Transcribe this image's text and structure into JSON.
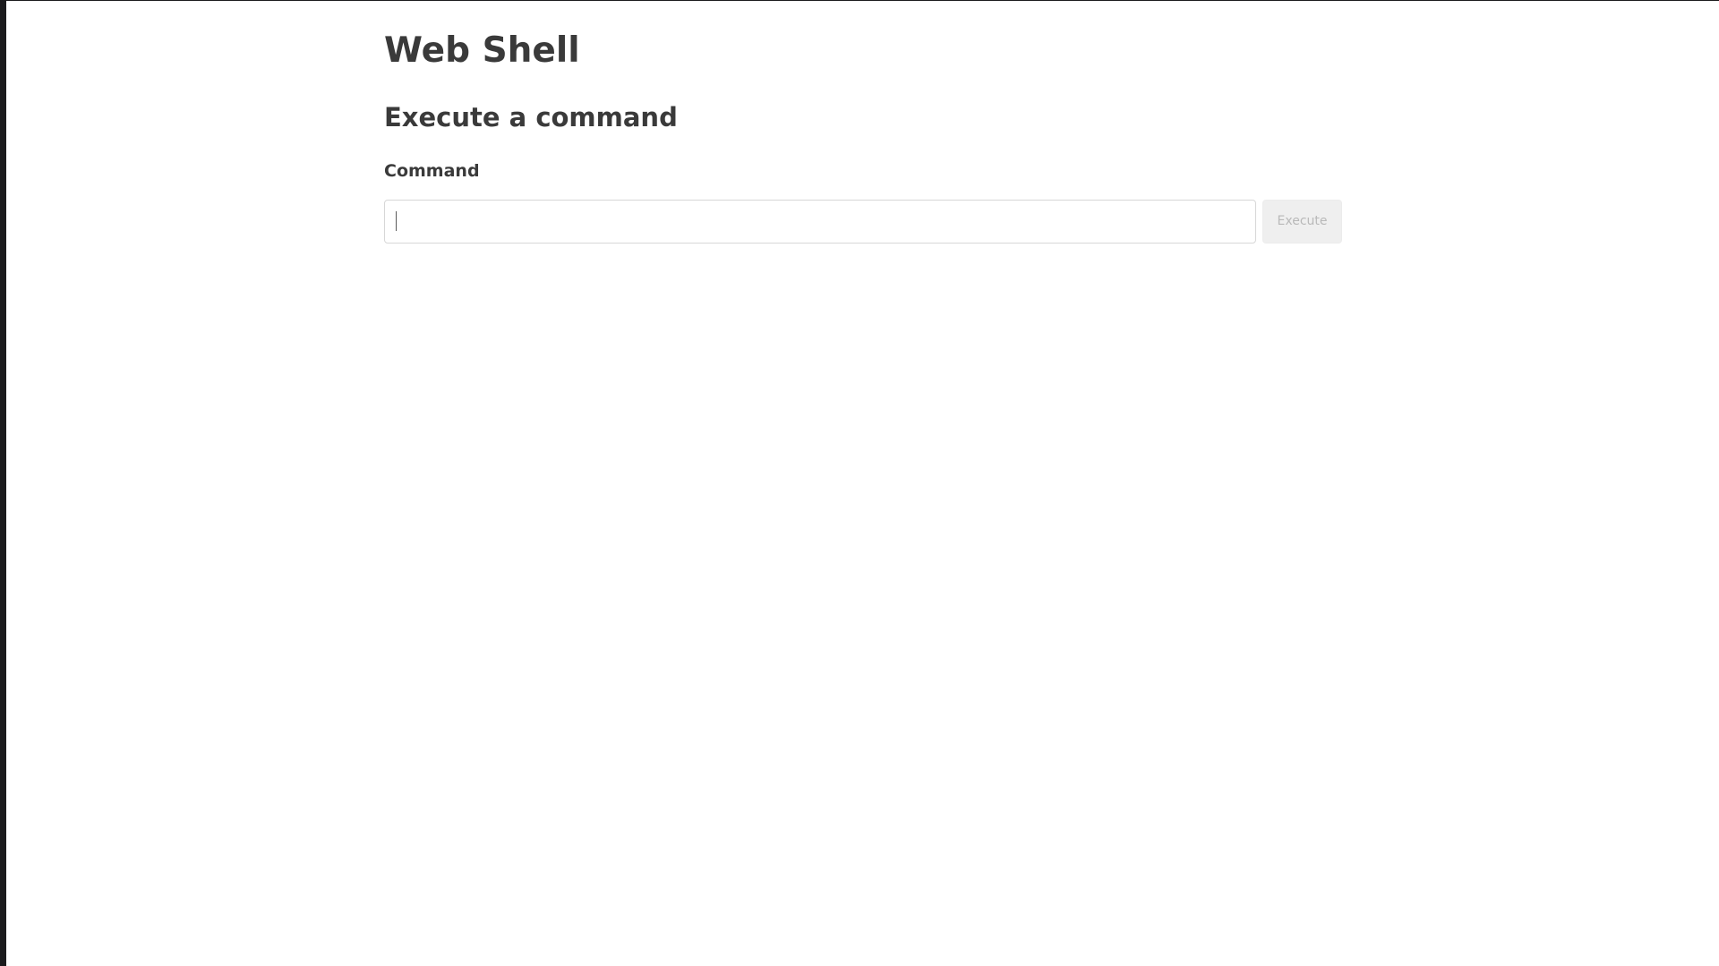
{
  "page": {
    "title": "Web Shell"
  },
  "section": {
    "title": "Execute a command"
  },
  "form": {
    "command_label": "Command",
    "command_value": "",
    "command_placeholder": "",
    "execute_label": "Execute"
  },
  "colors": {
    "background": "#ffffff",
    "text": "#3a3a3a",
    "button_background": "#efefef",
    "button_text": "#b9b9b9",
    "input_border": "#d7d7d7"
  }
}
